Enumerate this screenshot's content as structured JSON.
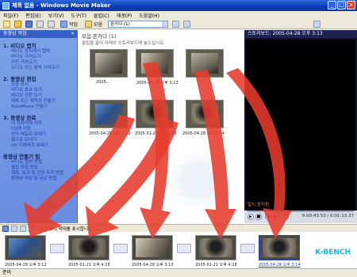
{
  "window": {
    "title": "제목 없음 - Windows Movie Maker"
  },
  "menu": [
    "파일(F)",
    "편집(E)",
    "보기(V)",
    "도구(T)",
    "클립(C)",
    "재생(P)",
    "도움말(H)"
  ],
  "toolbar": {
    "tasks_label": "작업",
    "collections_label": "모음",
    "collection_value": "폰카다 (1)"
  },
  "tasks": {
    "header": "동영상 작업",
    "groups": [
      {
        "title": "1. 비디오 캡처",
        "items": [
          "비디오 장치에서 캡처",
          "비디오 가져오기",
          "사진 가져오기",
          "오디오 또는 음악 가져오기"
        ]
      },
      {
        "title": "2. 동영상 편집",
        "items": [
          "모음 표시",
          "비디오 효과 보기",
          "비디오 전환 보기",
          "제목 또는 제작진 만들기",
          "AutoMovie 만들기"
        ]
      },
      {
        "title": "3. 동영상 완료",
        "items": [
          "내 컴퓨터에 저장",
          "CD에 저장",
          "전자 메일로 보내기",
          "웹으로 보내기",
          "DV 카메라로 보내기"
        ]
      },
      {
        "title": "동영상 만들기 팁",
        "items": [
          "비디오 캡처 방법",
          "클립 편집 방법",
          "제목, 효과 및 전환 추가 방법",
          "동영상 저장 및 공유 방법"
        ]
      }
    ]
  },
  "collection": {
    "title": "모음:폰카다 (1)",
    "subtitle": "클립을 끌어 아래의 스토리보드에 놓으십시오.",
    "clips": [
      {
        "caption": "2005..."
      },
      {
        "caption": "2005-04-28 오후 3:13"
      },
      {
        "caption": ""
      },
      {
        "caption": "2005-04-28 오후 3:12"
      },
      {
        "caption": "2005-01-21 오후 4:18"
      },
      {
        "caption": "2005-04-28 오후 3:14"
      }
    ]
  },
  "monitor": {
    "title": "스토리보드: 2005-04-28 오후 3:13",
    "status": "일시 중지됨",
    "timecode": "0:00:43.53 / 0:01:13.37"
  },
  "storyboard": {
    "toolbar_label": "시간 표시 막대를 표시합니다.",
    "clips": [
      {
        "caption": "2005-04-28 오후 3:12",
        "selected": false
      },
      {
        "caption": "2005-01-21 오후 4:18",
        "selected": false
      },
      {
        "caption": "2005-04-28 오후 3:13",
        "selected": false
      },
      {
        "caption": "2005-01-21 오후 4:18",
        "selected": false
      },
      {
        "caption": "2005-04-28 오후 3:14",
        "selected": true
      }
    ],
    "watermark": "K-BENCH"
  },
  "status_bar": {
    "text": "준비"
  },
  "colors": {
    "title_bar": "#0a3cb8",
    "tasks_bg": "#7ba2e7",
    "monitor_bg": "#12132a",
    "arrow": "#e53b2c"
  }
}
